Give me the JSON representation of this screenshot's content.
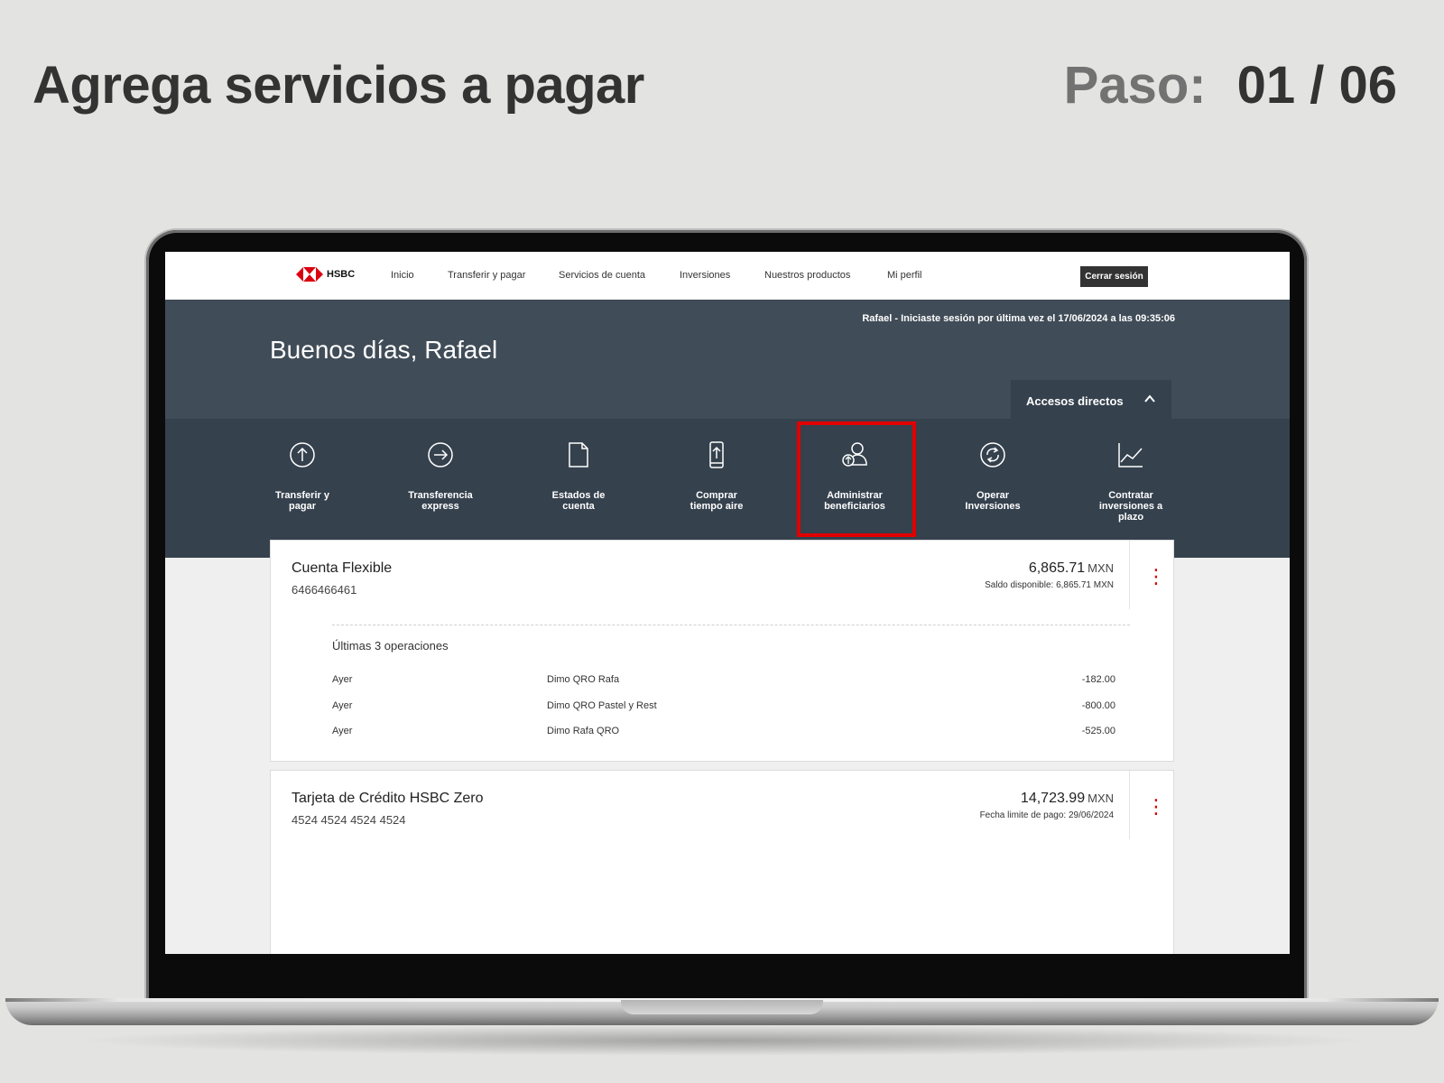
{
  "slide": {
    "title": "Agrega servicios a pagar",
    "step_label": "Paso:",
    "step_value": "01 / 06"
  },
  "navbar": {
    "logo_text": "HSBC",
    "items": [
      "Inicio",
      "Transferir y pagar",
      "Servicios de cuenta",
      "Inversiones",
      "Nuestros productos",
      "Mi perfil"
    ],
    "logout_label": "Cerrar sesión"
  },
  "hero": {
    "last_login": "Rafael - Iniciaste sesión por última vez el 17/06/2024 a las 09:35:06",
    "greeting": "Buenos días, Rafael",
    "accesos_label": "Accesos directos"
  },
  "shortcuts": [
    {
      "label_1": "Transferir y",
      "label_2": "pagar",
      "label_3": "",
      "icon": "arrow-up-circle-icon"
    },
    {
      "label_1": "Transferencia",
      "label_2": "express",
      "label_3": "",
      "icon": "arrow-right-circle-icon"
    },
    {
      "label_1": "Estados de",
      "label_2": "cuenta",
      "label_3": "",
      "icon": "document-icon"
    },
    {
      "label_1": "Comprar",
      "label_2": "tiempo aire",
      "label_3": "",
      "icon": "phone-upload-icon"
    },
    {
      "label_1": "Administrar",
      "label_2": "beneficiarios",
      "label_3": "",
      "icon": "user-transfer-icon"
    },
    {
      "label_1": "Operar",
      "label_2": "Inversiones",
      "label_3": "",
      "icon": "refresh-circle-icon"
    },
    {
      "label_1": "Contratar",
      "label_2": "inversiones a",
      "label_3": "plazo",
      "icon": "line-chart-icon"
    }
  ],
  "accounts": [
    {
      "name": "Cuenta Flexible",
      "number": "6466466461",
      "amount": "6,865.71",
      "currency": "MXN",
      "sub": "Saldo disponible: 6,865.71 MXN",
      "ops_title": "Últimas 3 operaciones",
      "ops": [
        {
          "date": "Ayer",
          "desc": "Dimo QRO Rafa",
          "amount": "-182.00"
        },
        {
          "date": "Ayer",
          "desc": "Dimo QRO Pastel y Rest",
          "amount": "-800.00"
        },
        {
          "date": "Ayer",
          "desc": "Dimo Rafa QRO",
          "amount": "-525.00"
        }
      ]
    },
    {
      "name": "Tarjeta de Crédito HSBC Zero",
      "number": "4524 4524 4524 4524",
      "amount": "14,723.99",
      "currency": "MXN",
      "sub": "Fecha limite de pago: 29/06/2024"
    }
  ],
  "colors": {
    "hero_bg": "#404c57",
    "shortcuts_bg": "#35414d",
    "brand_red": "#db0011",
    "highlight": "#e00000"
  }
}
